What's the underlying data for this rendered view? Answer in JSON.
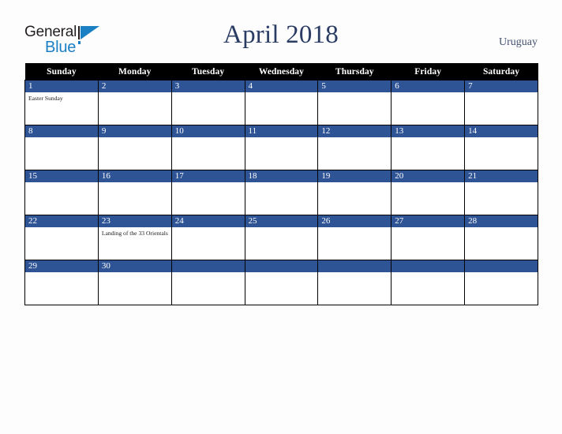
{
  "brand": {
    "name_part_1": "General",
    "name_part_2": "Blue",
    "triangle_icon": "triangle-icon"
  },
  "header": {
    "month_title": "April 2018",
    "country": "Uruguay"
  },
  "colors": {
    "header_bar": "#000000",
    "day_band": "#2f5496",
    "title_text": "#2a3c63",
    "brand_blue": "#1b7fc4",
    "page_background": "#fdfdfd",
    "cell_background": "#ffffff",
    "grid_border": "#000000"
  },
  "calendar": {
    "weekday_headers": [
      "Sunday",
      "Monday",
      "Tuesday",
      "Wednesday",
      "Thursday",
      "Friday",
      "Saturday"
    ],
    "weeks": [
      [
        {
          "day": "1",
          "event": "Easter Sunday",
          "filled": true
        },
        {
          "day": "2",
          "event": "",
          "filled": true
        },
        {
          "day": "3",
          "event": "",
          "filled": true
        },
        {
          "day": "4",
          "event": "",
          "filled": true
        },
        {
          "day": "5",
          "event": "",
          "filled": true
        },
        {
          "day": "6",
          "event": "",
          "filled": true
        },
        {
          "day": "7",
          "event": "",
          "filled": true
        }
      ],
      [
        {
          "day": "8",
          "event": "",
          "filled": true
        },
        {
          "day": "9",
          "event": "",
          "filled": true
        },
        {
          "day": "10",
          "event": "",
          "filled": true
        },
        {
          "day": "11",
          "event": "",
          "filled": true
        },
        {
          "day": "12",
          "event": "",
          "filled": true
        },
        {
          "day": "13",
          "event": "",
          "filled": true
        },
        {
          "day": "14",
          "event": "",
          "filled": true
        }
      ],
      [
        {
          "day": "15",
          "event": "",
          "filled": true
        },
        {
          "day": "16",
          "event": "",
          "filled": true
        },
        {
          "day": "17",
          "event": "",
          "filled": true
        },
        {
          "day": "18",
          "event": "",
          "filled": true
        },
        {
          "day": "19",
          "event": "",
          "filled": true
        },
        {
          "day": "20",
          "event": "",
          "filled": true
        },
        {
          "day": "21",
          "event": "",
          "filled": true
        }
      ],
      [
        {
          "day": "22",
          "event": "",
          "filled": true
        },
        {
          "day": "23",
          "event": "Landing of the 33 Orientals",
          "filled": true
        },
        {
          "day": "24",
          "event": "",
          "filled": true
        },
        {
          "day": "25",
          "event": "",
          "filled": true
        },
        {
          "day": "26",
          "event": "",
          "filled": true
        },
        {
          "day": "27",
          "event": "",
          "filled": true
        },
        {
          "day": "28",
          "event": "",
          "filled": true
        }
      ],
      [
        {
          "day": "29",
          "event": "",
          "filled": true
        },
        {
          "day": "30",
          "event": "",
          "filled": true
        },
        {
          "day": "",
          "event": "",
          "filled": false
        },
        {
          "day": "",
          "event": "",
          "filled": false
        },
        {
          "day": "",
          "event": "",
          "filled": false
        },
        {
          "day": "",
          "event": "",
          "filled": false
        },
        {
          "day": "",
          "event": "",
          "filled": false
        }
      ]
    ]
  }
}
